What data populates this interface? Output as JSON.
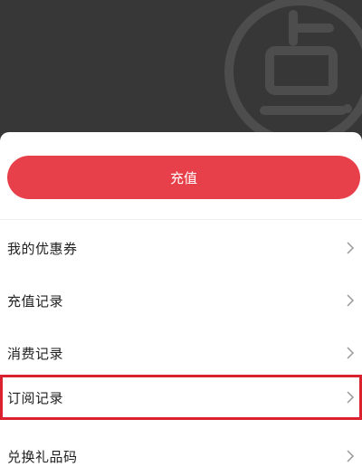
{
  "header": {
    "logo_icon": "dian-logo-icon",
    "background": "#373737"
  },
  "actions": {
    "recharge_label": "充值",
    "accent": "#e8404a"
  },
  "menu": {
    "items": [
      {
        "label": "我的优惠券",
        "icon": "chevron-right-icon"
      },
      {
        "label": "充值记录",
        "icon": "chevron-right-icon"
      },
      {
        "label": "消费记录",
        "icon": "chevron-right-icon"
      },
      {
        "label": "订阅记录",
        "icon": "chevron-right-icon",
        "highlighted": true
      },
      {
        "label": "兑换礼品码",
        "icon": "chevron-right-icon"
      }
    ],
    "highlight_color": "#d9222e"
  }
}
